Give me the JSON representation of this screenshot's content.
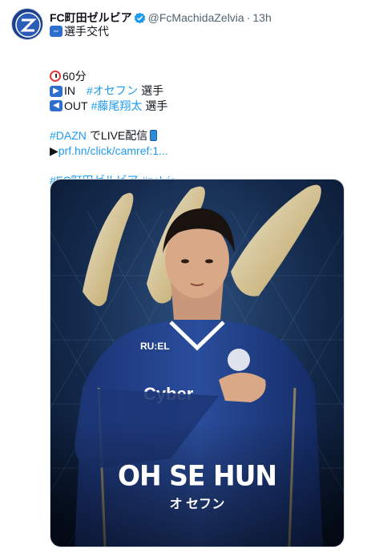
{
  "tweet": {
    "display_name": "FC町田ゼルビア",
    "handle": "@FcMachidaZelvia",
    "separator": "·",
    "time": "13h",
    "verified_icon": "verified-badge-icon",
    "lines": {
      "l1_text": "選手交代",
      "l2_time": "60分",
      "l3_label": "IN",
      "l3_tag": "#オセフン",
      "l3_suffix": "選手",
      "l4_label": "OUT",
      "l4_tag": "#藤尾翔太",
      "l4_suffix": "選手",
      "l5_tag": "#DAZN",
      "l5_text": "でLIVE配信",
      "l6_link": "prf.hn/click/camref:1...",
      "l7_tag1": "#FC町田ゼルビア",
      "l7_tag2": "#zelvia"
    },
    "media": {
      "player_name_en": "OH SE HUN",
      "player_name_jp": "オ セフン",
      "jersey_sponsor": "Cyber",
      "jersey_brand": "RU:EL"
    },
    "colors": {
      "link": "#1d9bf0",
      "muted": "#536471",
      "kit_blue": "#1f3f8a"
    }
  }
}
